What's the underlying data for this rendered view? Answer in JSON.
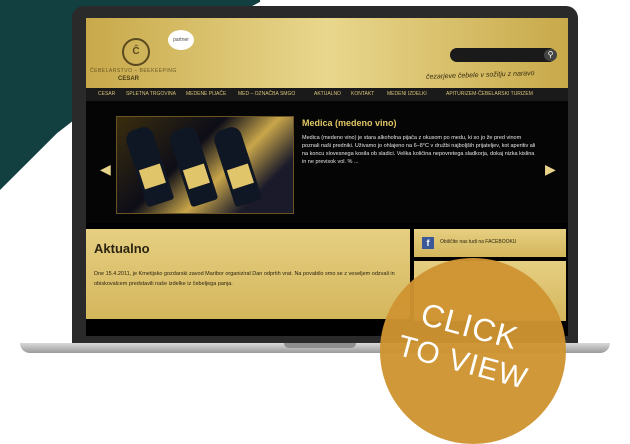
{
  "site": {
    "logo_mark": "Ĉ",
    "logo_sub": "ČEBELARSTVO – BEEKEEPING",
    "logo_name": "CESAR",
    "partner_logo": "partner",
    "slogan": "čezarjeve čebele v sožitju z naravo"
  },
  "search": {
    "icon": "search-icon",
    "glyph": "⚲"
  },
  "nav": {
    "items": [
      "CESAR",
      "SPLETNA TRGOVINA",
      "MEDENE PIJAČE",
      "MED – OZNAČBA SMGO",
      "AKTUALNO",
      "KONTAKT",
      "MEDENI IZDELKI",
      "APITURIZEM-ČEBELARSKI TURIZEM"
    ]
  },
  "slider": {
    "title": "Medica (medeno vino)",
    "text": "Medica (medeno vino) je stara alkoholna pijača z okusom po medu, ki so jo že pred vinom poznali naši predniki. Uživamo jo ohlajeno na 6–8°C v družbi najboljših prijateljev, kot aperitiv ali na koncu slovesnega kosila ob sladici. Velika količina nepovretega sladkorja, dokaj nizka kislina in ne previsok vol. % ...",
    "prev": "◀",
    "next": "▶"
  },
  "news": {
    "title": "Aktualno",
    "text": "Dne 15.4.2011, je Kmetijsko gozdarski zavod Maribor organiziral Dan odprtih vrat. Na povabilo smo se z veseljem odzvali in obiskovalcem predstavili naše izdelke iz čebeljega panja."
  },
  "facebook": {
    "icon": "f",
    "text": "Obiščite nas tudi na FACEBOOKU"
  },
  "badge": {
    "line1": "CLICK",
    "line2": "TO VIEW"
  },
  "colors": {
    "accent": "#d4b65c",
    "badge": "#cf9432",
    "teal": "#123f3f"
  }
}
